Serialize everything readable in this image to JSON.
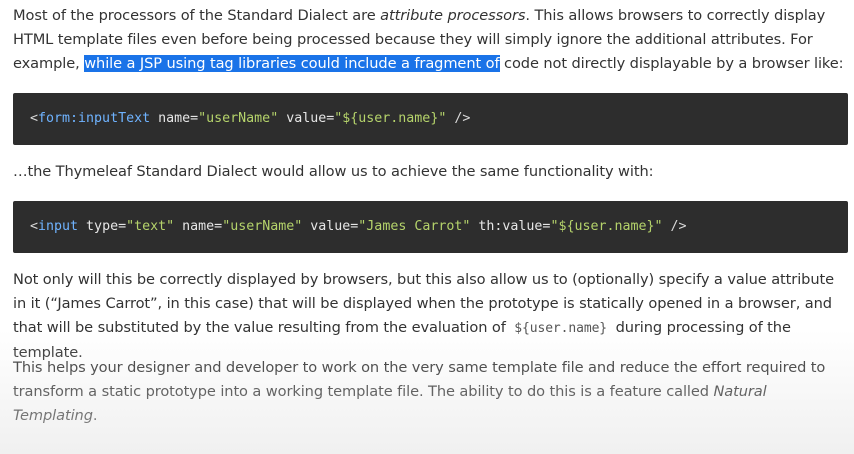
{
  "para1": {
    "a": "Most of the processors of the Standard Dialect are ",
    "em": "attribute processors",
    "b": ". This allows browsers to correctly display HTML template files even before being processed because they will simply ignore the additional attributes. For example, ",
    "highlight": "while a JSP using tag libraries could include a fragment of",
    "c": " code not directly displayable by a browser like:"
  },
  "code1": {
    "open": "<",
    "tag": "form:inputText",
    "attr1": " name=",
    "val1": "\"userName\"",
    "attr2": " value=",
    "val2": "\"${user.name}\"",
    "close": " />"
  },
  "para2": "…the Thymeleaf Standard Dialect would allow us to achieve the same functionality with:",
  "code2": {
    "open": "<",
    "tag": "input",
    "attr1": " type=",
    "val1": "\"text\"",
    "attr2": " name=",
    "val2": "\"userName\"",
    "attr3": " value=",
    "val3": "\"James Carrot\"",
    "attr4": " th:value=",
    "val4": "\"${user.name}\"",
    "close": " />"
  },
  "para3": {
    "a": "Not only will this be correctly displayed by browsers, but this also allow us to (optionally) specify a value attribute in it (“James Carrot”, in this case) that will be displayed when the prototype is statically opened in a browser, and that will be substituted by the value resulting from the evaluation of ",
    "code": "${user.name}",
    "b": " during processing of the template."
  },
  "para4": {
    "a": "This helps your designer and developer to work on the very same template file and reduce the effort required to transform a static prototype into a working template file. The ability to do this is a feature called ",
    "em": "Natural Templating",
    "b": "."
  }
}
